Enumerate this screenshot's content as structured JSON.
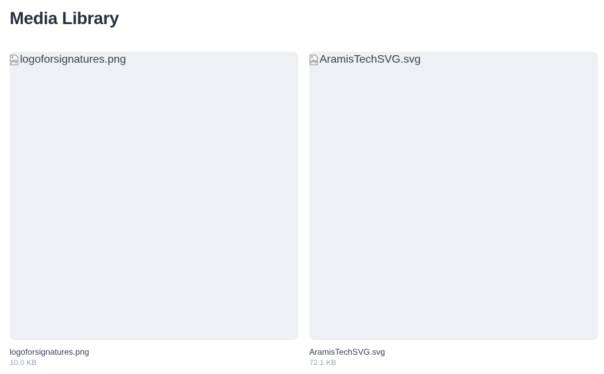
{
  "page": {
    "title": "Media Library"
  },
  "media": [
    {
      "alt": "logoforsignatures.png",
      "name": "logoforsignatures.png",
      "size": "10.0 KB",
      "thumbnail_icon": "broken-image-icon"
    },
    {
      "alt": "AramisTechSVG.svg",
      "name": "AramisTechSVG.svg",
      "size": "72.1 KB",
      "thumbnail_icon": "broken-image-icon"
    }
  ],
  "colors": {
    "thumbnail_bg": "#eff0f3",
    "title": "#2a3040",
    "meta": "#9ca3af"
  }
}
